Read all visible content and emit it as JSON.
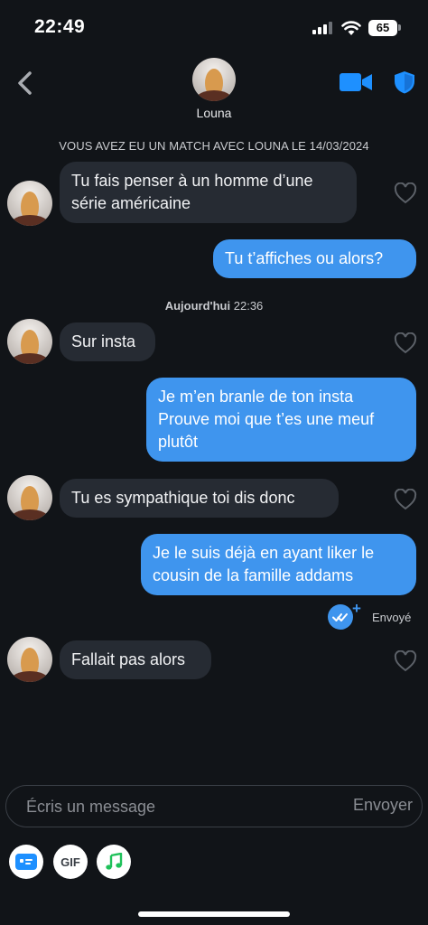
{
  "status_bar": {
    "time": "22:49",
    "battery": "65"
  },
  "header": {
    "name": "Louna"
  },
  "match_banner": "VOUS AVEZ EU UN MATCH AVEC LOUNA LE 14/03/2024",
  "date_separator": {
    "day": "Aujourd'hui",
    "time": "22:36"
  },
  "messages": [
    {
      "from": "them",
      "lines": [
        "Tu fais penser à un homme d’une",
        "série américaine"
      ]
    },
    {
      "from": "me",
      "lines": [
        "Tu t’affiches ou alors?"
      ]
    },
    {
      "from": "them",
      "lines": [
        "Sur insta"
      ]
    },
    {
      "from": "me",
      "lines": [
        "Je m’en branle de ton insta",
        "Prouve moi que t’es une meuf",
        "plutôt"
      ]
    },
    {
      "from": "them",
      "lines": [
        "Tu es sympathique toi dis donc"
      ]
    },
    {
      "from": "me",
      "lines": [
        "Je le suis déjà en ayant liker le",
        "cousin de la famille addams"
      ]
    },
    {
      "from": "them",
      "lines": [
        "Fallait pas alors"
      ]
    }
  ],
  "sent_status": "Envoyé",
  "composer": {
    "placeholder": "Écris un message",
    "send_label": "Envoyer"
  },
  "toolbar": {
    "gif_label": "GIF"
  },
  "colors": {
    "background": "#111418",
    "incoming_bubble": "#262b33",
    "outgoing_bubble": "#3f95ee",
    "accent": "#1e90ff"
  },
  "icons": [
    "back-chevron-icon",
    "video-call-icon",
    "shield-icon",
    "heart-icon",
    "read-receipt-icon",
    "id-card-icon",
    "music-note-icon"
  ]
}
